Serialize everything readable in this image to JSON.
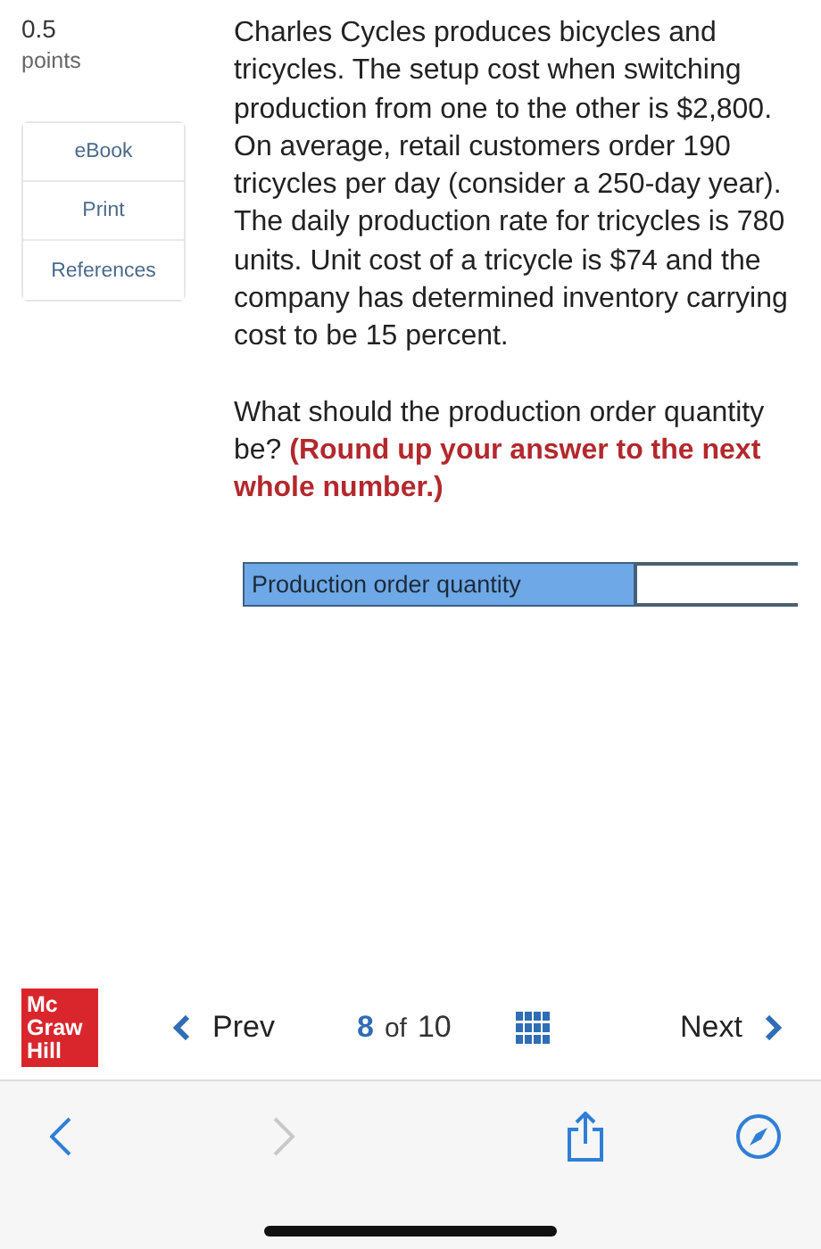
{
  "score": {
    "value": "0.5",
    "unit": "points"
  },
  "resources": [
    {
      "label": "eBook"
    },
    {
      "label": "Print"
    },
    {
      "label": "References"
    }
  ],
  "question": {
    "paragraphs": [
      "Charles Cycles produces bicycles and tricycles. The setup cost when switching production from one to the other is $2,800. On average, retail customers order 190 tricycles per day (consider a 250-day year). The daily production rate for tricycles is 780 units. Unit cost of a tricycle is $74 and the company has determined inventory carrying cost to be 15 percent.",
      "What should the production order quantity be? **(Round up your answer to the next whole number.)**"
    ]
  },
  "answer_table": {
    "label": "Production order quantity"
  },
  "nav": {
    "logo": [
      "Mc",
      "Graw",
      "Hill"
    ],
    "prev": "Prev",
    "current": "8",
    "of": "of",
    "total": "10",
    "next": "Next"
  },
  "browser_bar": {
    "back_disabled": false,
    "forward_disabled": true
  }
}
